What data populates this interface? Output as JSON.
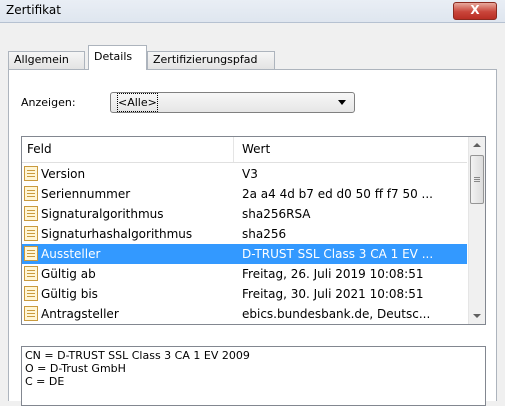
{
  "window": {
    "title": "Zertifikat",
    "close_label": "X"
  },
  "tabs": [
    {
      "label": "Allgemein"
    },
    {
      "label": "Details"
    },
    {
      "label": "Zertifizierungspfad"
    }
  ],
  "show": {
    "label": "Anzeigen:",
    "selected": "<Alle>"
  },
  "list": {
    "columns": {
      "feld": "Feld",
      "wert": "Wert"
    },
    "rows": [
      {
        "feld": "Version",
        "wert": "V3"
      },
      {
        "feld": "Seriennummer",
        "wert": "2a a4 4d b7 ed d0 50 ff f7 50 ..."
      },
      {
        "feld": "Signaturalgorithmus",
        "wert": "sha256RSA"
      },
      {
        "feld": "Signaturhashalgorithmus",
        "wert": "sha256"
      },
      {
        "feld": "Aussteller",
        "wert": "D-TRUST SSL Class 3 CA 1 EV ..."
      },
      {
        "feld": "Gültig ab",
        "wert": "Freitag, 26. Juli 2019 10:08:51"
      },
      {
        "feld": "Gültig bis",
        "wert": "Freitag, 30. Juli 2021 10:08:51"
      },
      {
        "feld": "Antragsteller",
        "wert": "ebics.bundesbank.de, Deutsc..."
      }
    ],
    "selected_index": 4
  },
  "detail": {
    "lines": [
      "CN = D-TRUST SSL Class 3 CA 1 EV 2009",
      "O = D-Trust GmbH",
      "C = DE"
    ]
  },
  "colors": {
    "selection": "#3399ff",
    "close_button": "#c9453a"
  }
}
